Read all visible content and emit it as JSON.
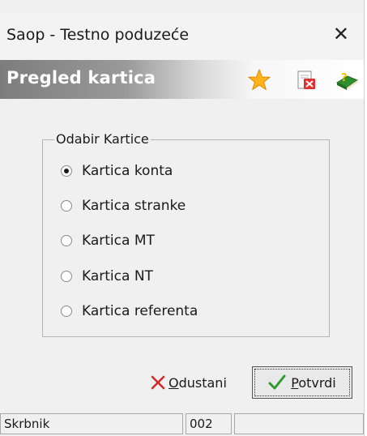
{
  "window": {
    "title": "Saop  - Testno poduzeće",
    "close_glyph": "✕"
  },
  "header": {
    "title": "Pregled kartica",
    "icons": [
      "star-icon",
      "close-document-icon",
      "help-book-icon"
    ]
  },
  "group": {
    "legend": "Odabir Kartice",
    "options": [
      {
        "label": "Kartica konta",
        "selected": true
      },
      {
        "label": "Kartica stranke",
        "selected": false
      },
      {
        "label": "Kartica MT",
        "selected": false
      },
      {
        "label": "Kartica NT",
        "selected": false
      },
      {
        "label": "Kartica referenta",
        "selected": false
      }
    ]
  },
  "buttons": {
    "cancel_mnemonic": "O",
    "cancel_rest": "dustani",
    "confirm_mnemonic": "P",
    "confirm_rest": "otvrdi"
  },
  "status": {
    "user": "Skrbnik",
    "code": "002",
    "extra": ""
  },
  "colors": {
    "accent_check": "#2e9a2e",
    "cancel_x": "#d42a2a",
    "header_text": "#ffffff"
  }
}
